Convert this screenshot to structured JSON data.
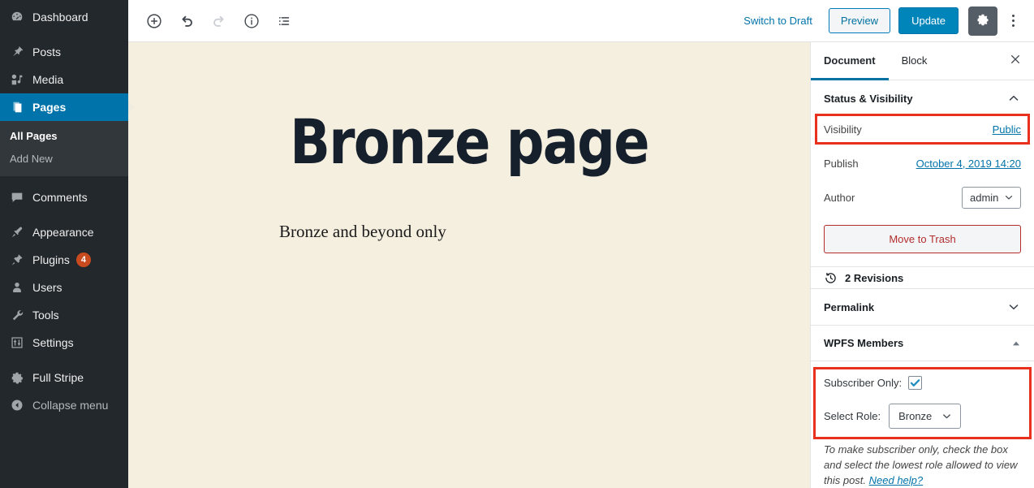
{
  "colors": {
    "admin_bg": "#23282d",
    "admin_submenu_bg": "#32373c",
    "accent_blue": "#0073aa",
    "update_blue": "#0085ba",
    "badge_orange": "#ca4a1f",
    "highlight_red": "#e8301c",
    "trash_red": "#b32d2e",
    "canvas_cream": "#f5efe0"
  },
  "sidebar": {
    "items": [
      {
        "label": "Dashboard",
        "icon": "dashboard-icon",
        "current": false
      },
      {
        "label": "Posts",
        "icon": "pin-icon",
        "current": false
      },
      {
        "label": "Media",
        "icon": "media-icon",
        "current": false
      },
      {
        "label": "Pages",
        "icon": "pages-icon",
        "current": true
      },
      {
        "label": "Comments",
        "icon": "comments-icon",
        "current": false
      },
      {
        "label": "Appearance",
        "icon": "brush-icon",
        "current": false
      },
      {
        "label": "Plugins",
        "icon": "plugin-icon",
        "current": false,
        "badge": "4"
      },
      {
        "label": "Users",
        "icon": "users-icon",
        "current": false
      },
      {
        "label": "Tools",
        "icon": "wrench-icon",
        "current": false
      },
      {
        "label": "Settings",
        "icon": "settings-sliders-icon",
        "current": false
      },
      {
        "label": "Full Stripe",
        "icon": "gear-icon",
        "current": false
      },
      {
        "label": "Collapse menu",
        "icon": "collapse-arrow-icon",
        "current": false
      }
    ],
    "submenu": [
      {
        "label": "All Pages",
        "current": true
      },
      {
        "label": "Add New",
        "current": false
      }
    ]
  },
  "toolbar": {
    "add_block_icon": "plus-circle-icon",
    "undo_icon": "undo-icon",
    "redo_icon": "redo-icon",
    "info_icon": "info-circle-icon",
    "list_view_icon": "list-view-icon",
    "switch_to_draft_label": "Switch to Draft",
    "preview_label": "Preview",
    "update_label": "Update",
    "settings_gear_icon": "gear-icon",
    "more_menu_icon": "vertical-ellipsis-icon"
  },
  "editor": {
    "title": "Bronze page",
    "body": "Bronze and beyond only"
  },
  "settings_panel": {
    "tabs": [
      {
        "label": "Document",
        "active": true
      },
      {
        "label": "Block",
        "active": false
      }
    ],
    "close_icon": "close-icon",
    "status_visibility": {
      "title": "Status & Visibility",
      "collapse_icon": "chevron-up-icon",
      "visibility_label": "Visibility",
      "visibility_value": "Public",
      "publish_label": "Publish",
      "publish_value": "October 4, 2019 14:20",
      "author_label": "Author",
      "author_value": "admin",
      "author_options": [
        "admin"
      ],
      "trash_label": "Move to Trash"
    },
    "revisions": {
      "label": "2 Revisions",
      "icon": "revision-clock-icon"
    },
    "permalink": {
      "title": "Permalink",
      "collapse_icon": "chevron-down-icon"
    },
    "wpfs_members": {
      "title": "WPFS Members",
      "collapse_icon": "triangle-up-icon",
      "subscriber_only_label": "Subscriber Only:",
      "subscriber_only_checked": true,
      "checkmark_icon": "checkmark-icon",
      "select_role_label": "Select Role:",
      "select_role_value": "Bronze",
      "select_role_options": [
        "Bronze"
      ],
      "help_text": "To make subscriber only, check the box and select the lowest role allowed to view this post. ",
      "help_link": "Need help?"
    }
  }
}
